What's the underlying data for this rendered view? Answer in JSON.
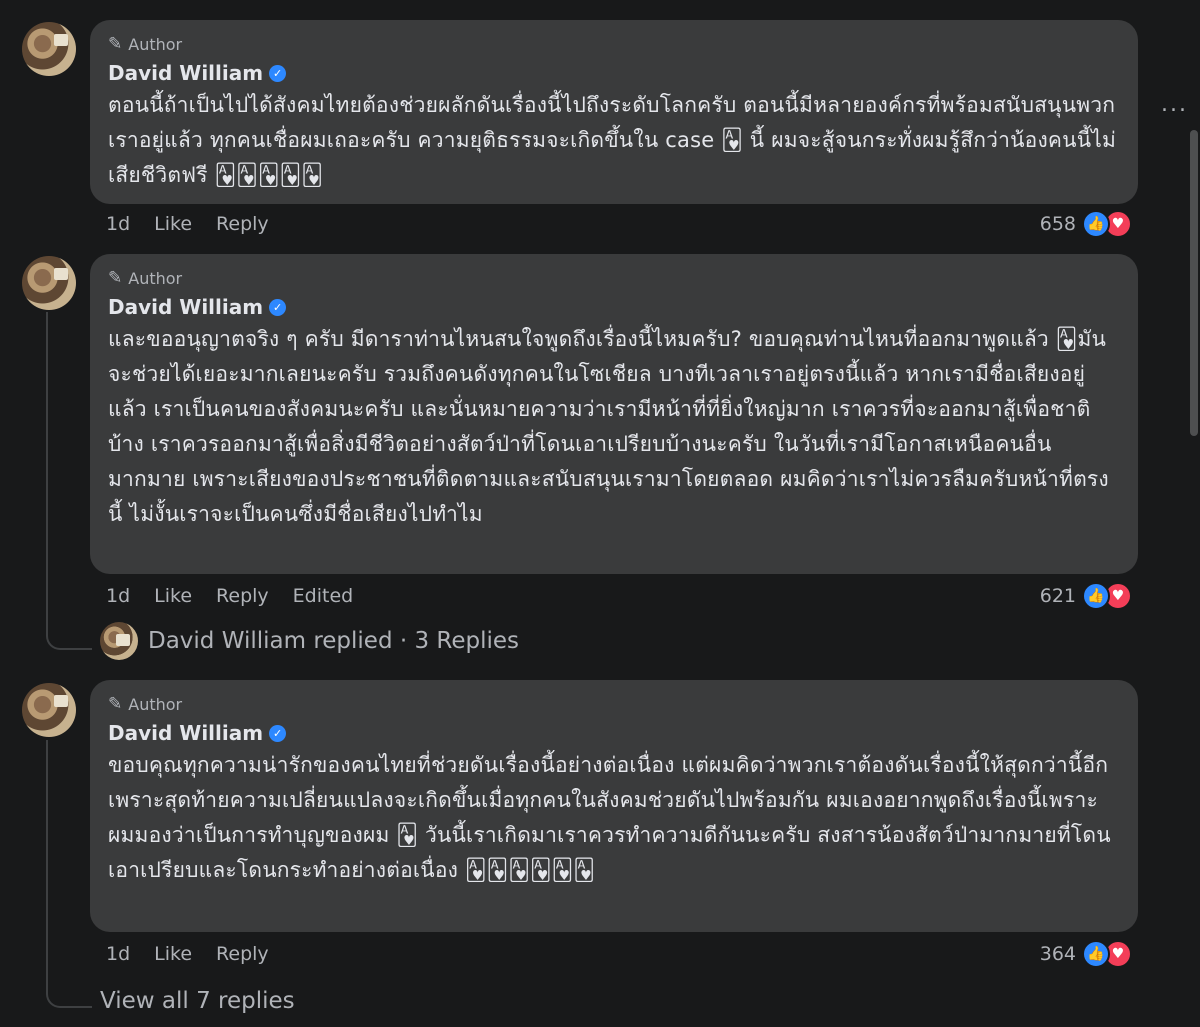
{
  "comments": [
    {
      "badge": "Author",
      "name": "David William",
      "text": "ตอนนี้ถ้าเป็นไปได้สังคมไทยต้องช่วยผลักดันเรื่องนี้ไปถึงระดับโลกครับ ตอนนี้มีหลายองค์กรที่พร้อมสนับสนุนพวกเราอยู่แล้ว ทุกคนเชื่อผมเถอะครับ ความยุติธรรมจะเกิดขึ้นใน case 🂱 นี้ ผมจะสู้จนกระทั่งผมรู้สึกว่าน้องคนนี้ไม่เสียชีวิตฟรี 🂱🂱🂱🂱🂱",
      "time": "1d",
      "like": "Like",
      "reply": "Reply",
      "count": "658"
    },
    {
      "badge": "Author",
      "name": "David William",
      "text": "และขออนุญาตจริง ๆ ครับ มีดาราท่านไหนสนใจพูดถึงเรื่องนี้ไหมครับ? ขอบคุณท่านไหนที่ออกมาพูดแล้ว 🂱มันจะช่วยได้เยอะมากเลยนะครับ รวมถึงคนดังทุกคนในโซเชียล บางทีเวลาเราอยู่ตรงนี้แล้ว หากเรามีชื่อเสียงอยู่แล้ว เราเป็นคนของสังคมนะครับ และนั่นหมายความว่าเรามีหน้าที่ที่ยิ่งใหญ่มาก เราควรที่จะออกมาสู้เพื่อชาติบ้าง เราควรออกมาสู้เพื่อสิ่งมีชีวิตอย่างสัตว์ป่าที่โดนเอาเปรียบบ้างนะครับ ในวันที่เรามีโอกาสเหนือคนอื่นมากมาย เพราะเสียงของประชาชนที่ติดตามและสนับสนุนเรามาโดยตลอด ผมคิดว่าเราไม่ควรลืมครับหน้าที่ตรงนี้ ไม่งั้นเราจะเป็นคนซึ่งมีชื่อเสียงไปทำไม",
      "time": "1d",
      "like": "Like",
      "reply": "Reply",
      "edited": "Edited",
      "count": "621"
    },
    {
      "badge": "Author",
      "name": "David William",
      "text": "ขอบคุณทุกความน่ารักของคนไทยที่ช่วยดันเรื่องนี้อย่างต่อเนื่อง แต่ผมคิดว่าพวกเราต้องดันเรื่องนี้ให้สุดกว่านี้อีก เพราะสุดท้ายความเปลี่ยนแปลงจะเกิดขึ้นเมื่อทุกคนในสังคมช่วยดันไปพร้อมกัน ผมเองอยากพูดถึงเรื่องนี้เพราะผมมองว่าเป็นการทำบุญของผม 🂱 วันนี้เราเกิดมาเราควรทำความดีกันนะครับ สงสารน้องสัตว์ป่ามากมายที่โดนเอาเปรียบและโดนกระทำอย่างต่อเนื่อง 🂱🂱🂱🂱🂱🂱",
      "time": "1d",
      "like": "Like",
      "reply": "Reply",
      "count": "364"
    }
  ],
  "replies_summary": "David William replied · 3 Replies",
  "view_all": "View all 7 replies",
  "more": "...",
  "colors": {
    "background": "#18191a",
    "bubble": "#3a3b3c",
    "like": "#2d88ff",
    "love": "#f33e58",
    "secondary_text": "#b0b3b8"
  }
}
